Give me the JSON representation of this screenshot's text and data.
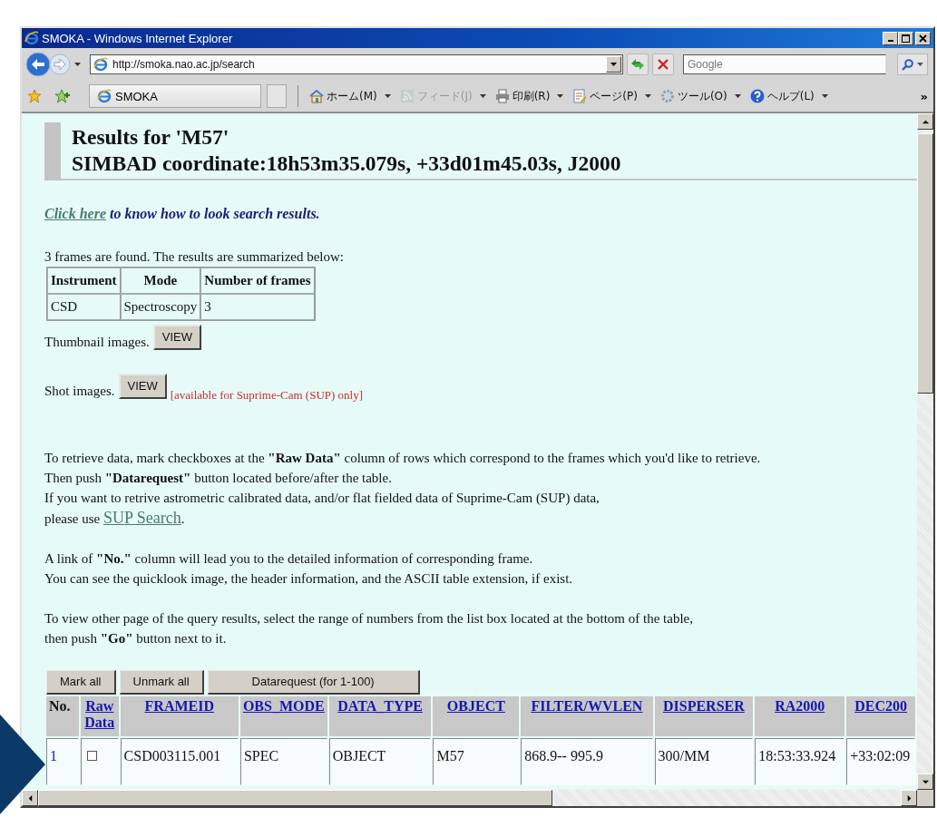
{
  "window": {
    "title": "SMOKA - Windows Internet Explorer"
  },
  "address_bar": {
    "url": "http://smoka.nao.ac.jp/search"
  },
  "search_box": {
    "placeholder": "Google"
  },
  "tab": {
    "label": "SMOKA"
  },
  "commands": [
    {
      "label": "ホーム(M)",
      "kind": "home",
      "disabled": false
    },
    {
      "label": "フィード(J)",
      "kind": "feed",
      "disabled": true
    },
    {
      "label": "印刷(R)",
      "kind": "print",
      "disabled": false
    },
    {
      "label": "ページ(P)",
      "kind": "page",
      "disabled": false
    },
    {
      "label": "ツール(O)",
      "kind": "tools",
      "disabled": false
    },
    {
      "label": "ヘルプ(L)",
      "kind": "help",
      "disabled": false
    }
  ],
  "toolbar_overflow": "»",
  "heading": [
    "Results for 'M57'",
    "SIMBAD coordinate:18h53m35.079s, +33d01m45.03s, J2000"
  ],
  "help_line": {
    "link": "Click here",
    "text": "to know how to look search results."
  },
  "summary_intro": "3 frames are found. The results are summarized below:",
  "summary_table": {
    "columns": [
      "Instrument",
      "Mode",
      "Number of frames"
    ],
    "rows": [
      [
        "CSD",
        "Spectroscopy",
        "3"
      ]
    ]
  },
  "thumbnail": {
    "label": "Thumbnail images.",
    "button": "VIEW"
  },
  "shot": {
    "label": "Shot images.",
    "button": "VIEW",
    "note": "[available for Suprime-Cam (SUP) only]"
  },
  "instructions": [
    [
      {
        "text": "To retrieve data, mark checkboxes at the **\"Raw Data\"** column of rows which correspond to the frames which you'd like to retrieve."
      },
      {
        "text": "Then push **\"Datarequest\"** button located before/after the table."
      },
      {
        "text": "If you want to retrive astrometric calibrated data, and/or flat fielded data of Suprime-Cam (SUP) data,"
      },
      {
        "text": "please use",
        "link": "SUP Search",
        "after": "."
      }
    ],
    [
      {
        "text": "A link of **\"No.\"** column will lead you to the detailed information of corresponding frame."
      },
      {
        "text": "You can see the quicklook image, the header information, and the ASCII table extension, if exist."
      }
    ],
    [
      {
        "text": "To view other page of the query results, select the range of numbers from the list box located at the bottom of the table,"
      },
      {
        "text": "then push **\"Go\"** button next to it."
      }
    ]
  ],
  "buttons": [
    "Mark all",
    "Unmark all",
    "Datarequest (for 1-100)"
  ],
  "results_table": {
    "columns": [
      {
        "label": "No.",
        "kind": "plain"
      },
      {
        "label": "Raw Data",
        "kind": "link"
      },
      {
        "label": "FRAMEID",
        "kind": "link"
      },
      {
        "label": "OBS_MODE",
        "kind": "link"
      },
      {
        "label": "DATA_TYPE",
        "kind": "link"
      },
      {
        "label": "OBJECT",
        "kind": "link"
      },
      {
        "label": "FILTER/WVLEN",
        "kind": "link"
      },
      {
        "label": "DISPERSER",
        "kind": "link"
      },
      {
        "label": "RA2000",
        "kind": "link"
      },
      {
        "label": "DEC200",
        "kind": "link"
      }
    ],
    "rows": [
      {
        "checked": false,
        "cells": [
          "1",
          "",
          "CSD003115.001",
          "SPEC",
          "OBJECT",
          "M57",
          "868.9-- 995.9",
          "300/MM",
          "18:53:33.924",
          "+33:02:09"
        ]
      }
    ]
  }
}
